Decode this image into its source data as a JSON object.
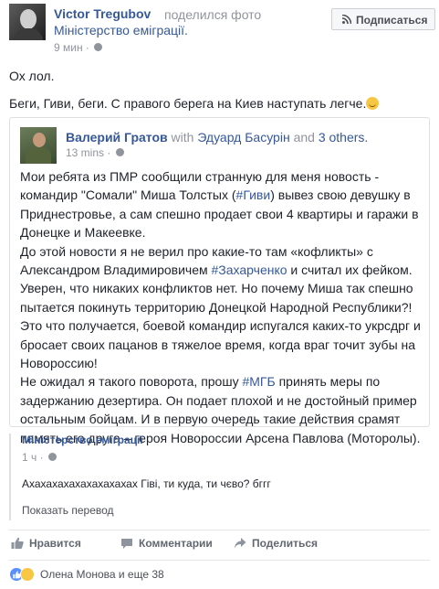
{
  "header": {
    "author": "Victor Tregubov",
    "verb": "поделился фото",
    "page": "Міністерство еміграції.",
    "time": "9 мин",
    "subscribe_label": "Подписаться"
  },
  "post": {
    "line1": "Ох лол.",
    "line2": "Беги, Гиви, беги. С правого берега на Киев наступать легче."
  },
  "shared": {
    "author": "Валерий Гратов",
    "with": "with",
    "tagged": "Эдуард Басурін",
    "and": "and",
    "others": "3 others.",
    "time": "13 mins",
    "body": {
      "p1a": "Мои ребята из ПМР сообщили странную для меня новость - командир \"Сомали\" Миша Толстых (",
      "tag1": "#Гиви",
      "p1b": ") вывез свою девушку в Приднестровье, а сам спешно продает свои 4 квартиры и гаражи в Донецке и Макеевке.",
      "p2a": "До этой новости я не верил про какие-то там «кофликты» с Александром Владимировичем ",
      "tag2": "#Захарченко",
      "p2b": " и считал их фейком. Уверен, что никаких конфликтов нет. Но почему Миша так спешно пытается покинуть территорию Донецкой Народной Республики?! Это что получается, боевой командир испугался каких-то укрсдрг и бросает своих пацанов в тяжелое время, когда враг точит зубы на Новороссию!",
      "p3a": "Не ожидал я такого поворота, прошу ",
      "tag3": "#МГБ",
      "p3b": " принять меры по задержанию дезертира. Он подает плохой и не достойный пример остальным бойцам. И в первую очередь такие действия срамят память его друга – героя Новороссии Арсена Павлова (Моторолы)."
    }
  },
  "comment": {
    "author": "Міністерство еміграції",
    "time": "1 ч",
    "text": "Ахахахахахахахахахах Гіві, ти куда, ти чєво? бггг",
    "translate": "Показать перевод"
  },
  "actions": {
    "like": "Нравится",
    "comment": "Комментарии",
    "share": "Поделиться"
  },
  "reactions": {
    "label": "Олена Монова и еще 38"
  },
  "colors": {
    "link": "#365899",
    "muted": "#90949c",
    "text": "#1d2129",
    "like_blue": "#5890ff",
    "haha_yellow": "#f7c744"
  }
}
